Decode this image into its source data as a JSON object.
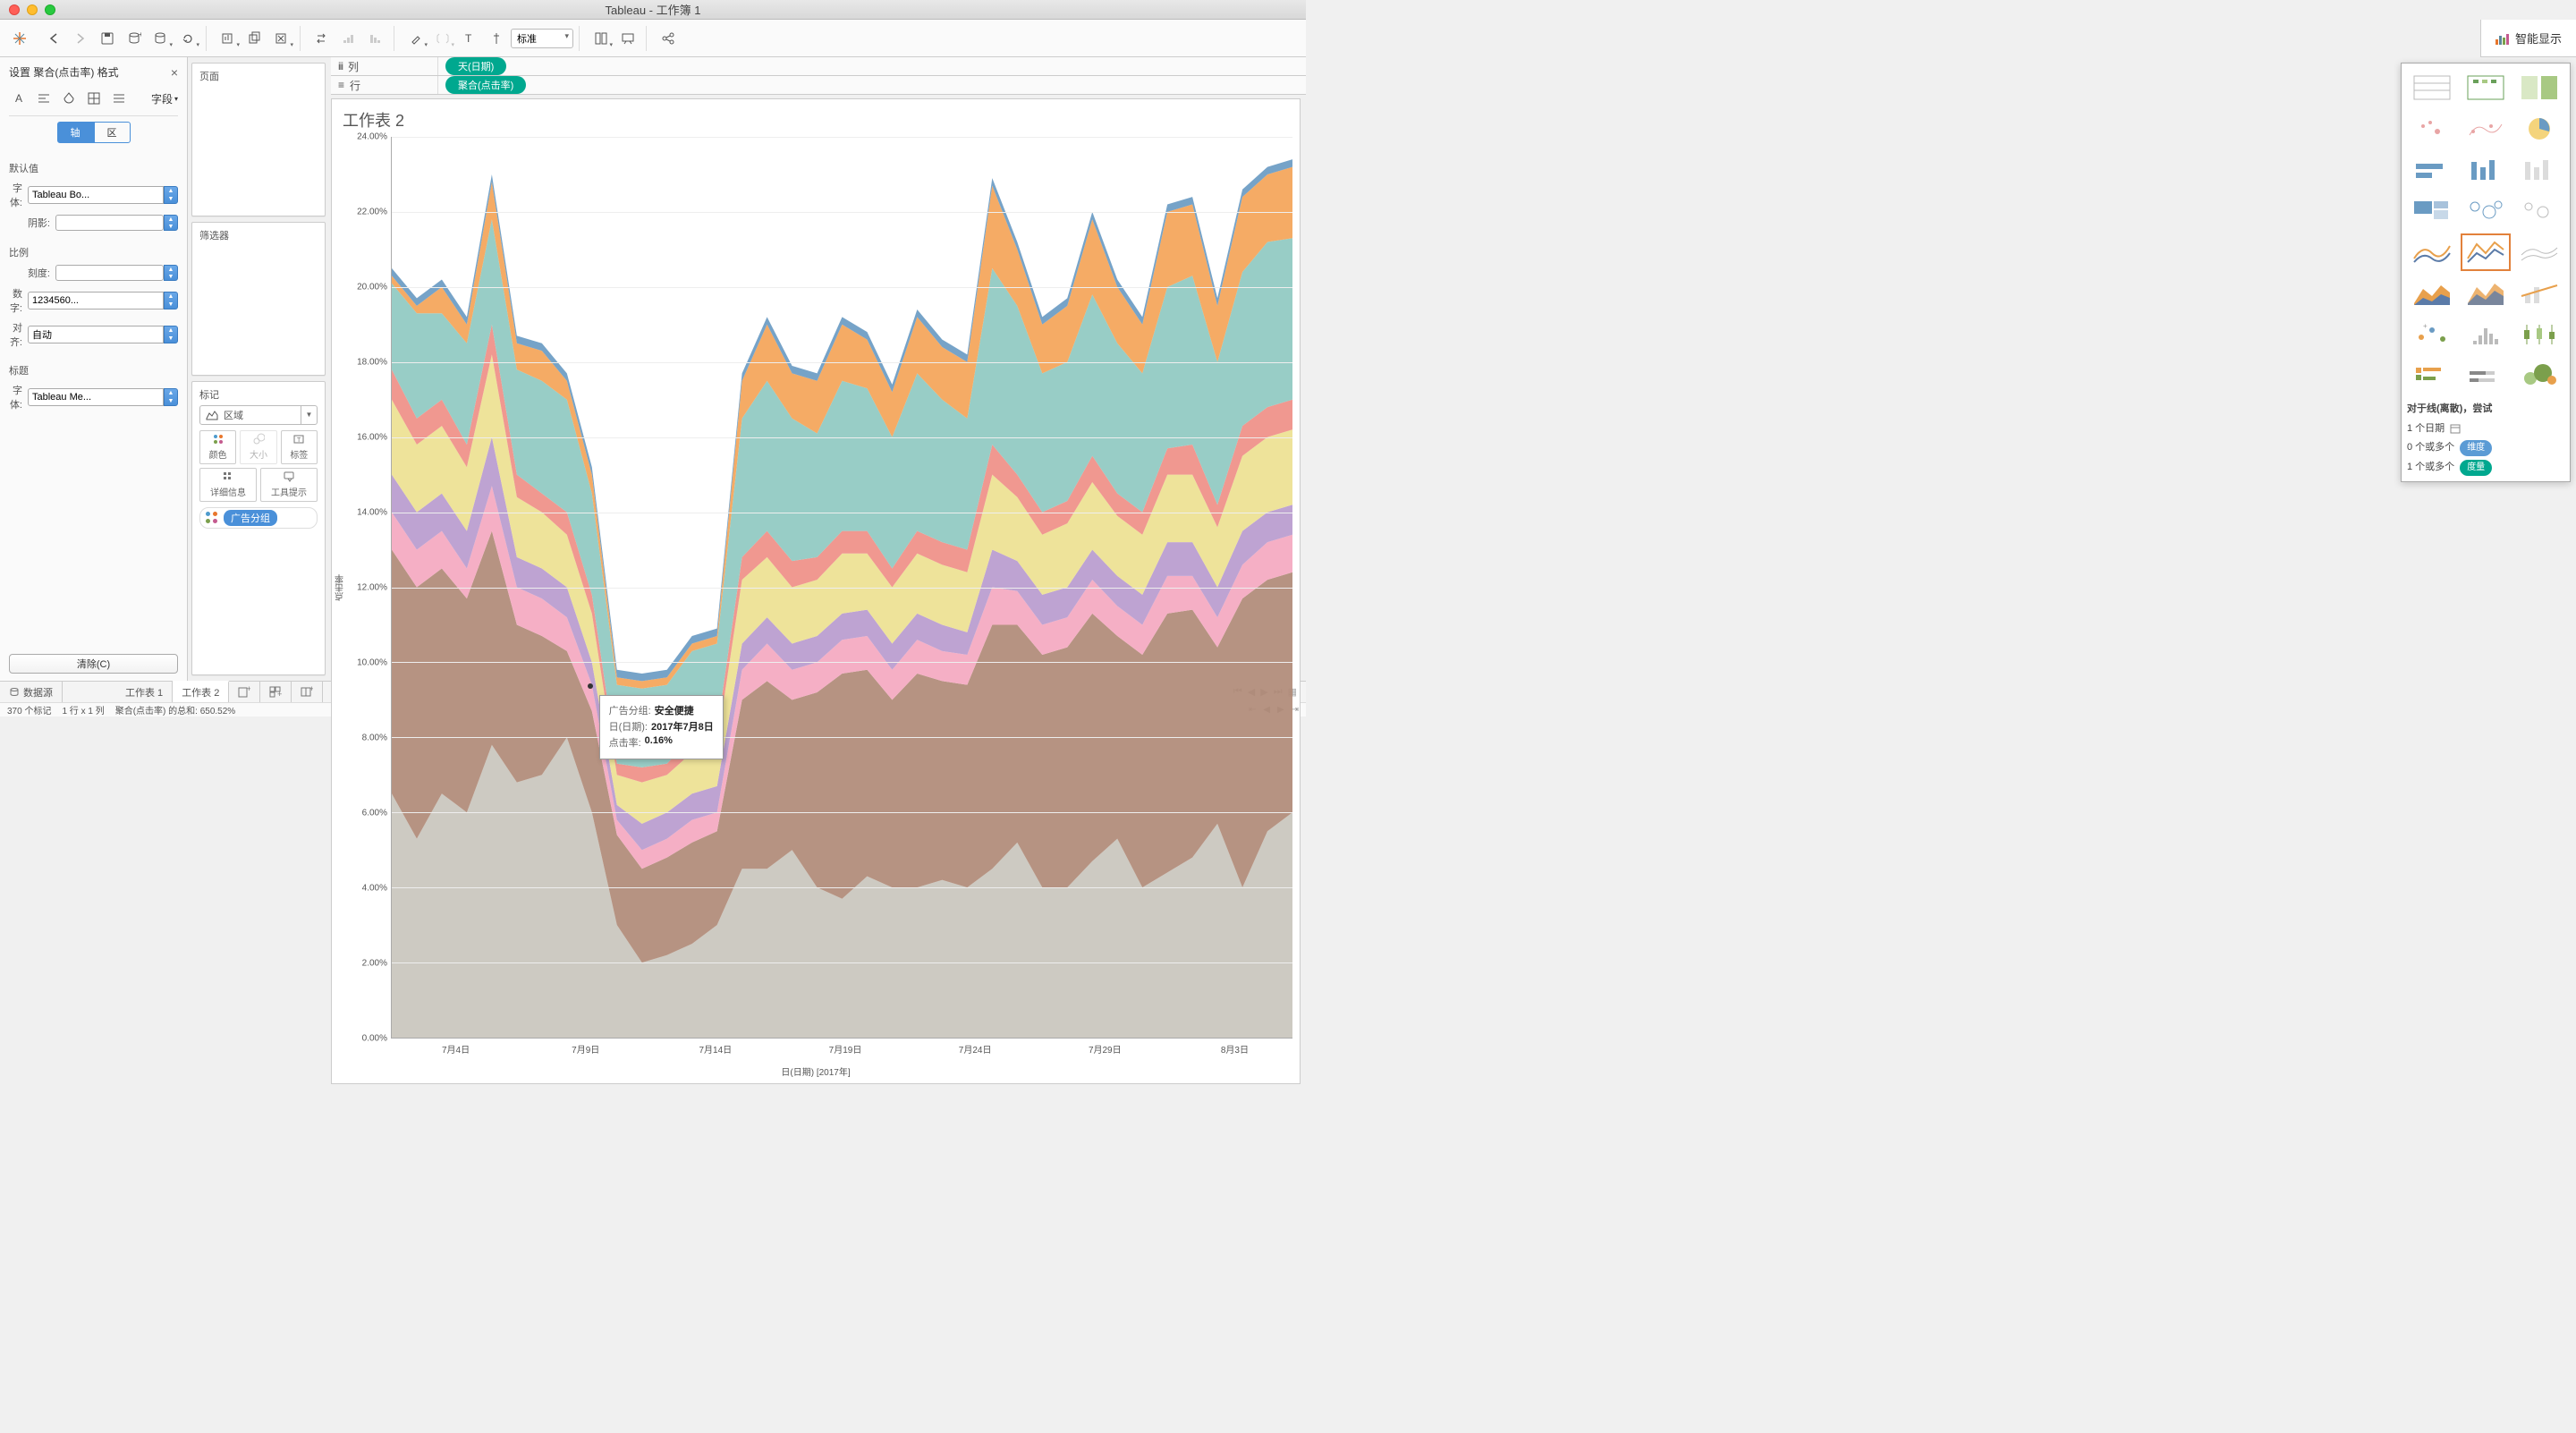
{
  "window": {
    "title": "Tableau - 工作簿 1"
  },
  "toolbar": {
    "standard_label": "标准",
    "showme_label": "智能显示"
  },
  "format_panel": {
    "title": "设置 聚合(点击率) 格式",
    "field_btn": "字段",
    "tab_axis": "轴",
    "tab_pane": "区",
    "section_defaults": "默认值",
    "row_font": "字体:",
    "font_value": "Tableau Bo...",
    "row_shade": "阴影:",
    "section_scale": "比例",
    "row_ticks": "刻度:",
    "row_numbers": "数字:",
    "numbers_value": "1234560...",
    "row_align": "对齐:",
    "align_value": "自动",
    "section_title": "标题",
    "row_font2": "字体:",
    "font2_value": "Tableau Me...",
    "clear_btn": "清除(C)"
  },
  "cards": {
    "pages": "页面",
    "filters": "筛选器",
    "marks": "标记",
    "mark_type": "区域",
    "color": "颜色",
    "size": "大小",
    "label": "标签",
    "detail": "详细信息",
    "tooltip": "工具提示",
    "pill_ad": "广告分组"
  },
  "shelves": {
    "columns": "列",
    "rows": "行",
    "col_pill": "天(日期)",
    "row_pill": "聚合(点击率)"
  },
  "sheet": {
    "title": "工作表 2"
  },
  "tooltip": {
    "k1": "广告分组:",
    "v1": "安全便捷",
    "k2": "日(日期):",
    "v2": "2017年7月8日",
    "k3": "点击率:",
    "v3": "0.16%"
  },
  "axes": {
    "ylabel": "点击率",
    "xlabel": "日(日期) [2017年]"
  },
  "showme": {
    "hint": "对于线(离散)，尝试",
    "l1": "1 个日期",
    "l2": "0 个或多个",
    "chip_dim": "维度",
    "l3": "1 个或多个",
    "chip_meas": "度量"
  },
  "tabs": {
    "datasource": "数据源",
    "ws1": "工作表 1",
    "ws2": "工作表 2"
  },
  "status": {
    "marks": "370 个标记",
    "rc": "1 行 x 1 列",
    "sum": "聚合(点击率) 的总和: 650.52%"
  },
  "chart_data": {
    "type": "area",
    "stacked": true,
    "title": "工作表 2",
    "ylabel": "点击率",
    "xlabel": "日(日期) [2017年]",
    "ylim": [
      0,
      24
    ],
    "y_format": "percent_2dp",
    "y_ticks": [
      "0.00%",
      "2.00%",
      "4.00%",
      "6.00%",
      "8.00%",
      "10.00%",
      "12.00%",
      "14.00%",
      "16.00%",
      "18.00%",
      "20.00%",
      "22.00%",
      "24.00%"
    ],
    "x_ticks": [
      "7月4日",
      "7月9日",
      "7月14日",
      "7月19日",
      "7月24日",
      "7月29日",
      "8月3日"
    ],
    "x_start": "2017-07-01",
    "x_end": "2017-08-06",
    "series_top_to_bottom": [
      "蓝",
      "橙",
      "青",
      "粉",
      "黄",
      "紫",
      "浅粉",
      "棕",
      "灰"
    ],
    "cumulative_top": [
      20.3,
      19.5,
      20.0,
      19.0,
      22.8,
      18.5,
      18.3,
      17.5,
      15.0,
      9.6,
      9.5,
      9.6,
      10.5,
      10.7,
      17.5,
      19.0,
      17.7,
      17.5,
      19.0,
      18.6,
      17.2,
      19.2,
      18.4,
      18.0,
      22.7,
      21.0,
      19.0,
      19.5,
      21.8,
      20.0,
      19.0,
      22.0,
      22.2,
      19.5,
      22.4,
      23.0,
      23.2
    ],
    "cumulative_after_orange": [
      20.1,
      19.3,
      19.3,
      18.5,
      21.8,
      17.8,
      17.5,
      17.0,
      14.5,
      9.4,
      9.3,
      9.4,
      10.3,
      10.5,
      16.5,
      17.5,
      16.5,
      16.1,
      17.5,
      17.3,
      16.0,
      17.7,
      17.0,
      16.5,
      20.5,
      19.5,
      17.7,
      18.0,
      19.8,
      18.5,
      17.7,
      20.0,
      20.3,
      18.0,
      20.4,
      21.2,
      21.3
    ],
    "cumulative_after_teal": [
      17.8,
      16.5,
      17.0,
      15.8,
      19.0,
      15.0,
      14.5,
      14.0,
      11.8,
      7.3,
      7.2,
      7.3,
      8.0,
      8.2,
      12.8,
      13.5,
      12.7,
      12.8,
      13.5,
      13.5,
      12.5,
      13.5,
      13.2,
      13.0,
      15.8,
      15.0,
      14.0,
      14.3,
      15.5,
      14.5,
      14.0,
      15.7,
      15.8,
      14.2,
      16.3,
      16.8,
      17.0
    ],
    "cumulative_after_salmon": [
      17.0,
      15.8,
      16.3,
      15.2,
      18.2,
      14.4,
      14.0,
      13.4,
      11.3,
      7.0,
      6.8,
      7.0,
      7.6,
      7.8,
      12.2,
      12.8,
      12.0,
      12.2,
      12.9,
      12.9,
      12.0,
      12.9,
      12.6,
      12.4,
      15.0,
      14.4,
      13.4,
      13.7,
      14.8,
      13.9,
      13.4,
      15.0,
      15.0,
      13.6,
      15.5,
      16.0,
      16.2
    ],
    "cumulative_after_yellow": [
      15.0,
      14.0,
      14.5,
      13.5,
      16.0,
      12.8,
      12.5,
      12.0,
      10.0,
      6.2,
      5.7,
      6.0,
      6.5,
      6.7,
      10.5,
      11.2,
      10.5,
      10.7,
      11.3,
      11.4,
      10.5,
      11.3,
      11.0,
      10.8,
      13.0,
      12.7,
      11.8,
      12.0,
      13.0,
      12.3,
      11.8,
      13.2,
      13.2,
      12.0,
      13.5,
      14.0,
      14.2
    ],
    "cumulative_after_purple": [
      14.0,
      13.0,
      13.5,
      12.5,
      14.7,
      12.0,
      11.7,
      11.2,
      9.4,
      5.8,
      5.0,
      5.3,
      5.8,
      6.0,
      9.8,
      10.5,
      9.8,
      10.0,
      10.6,
      10.7,
      9.8,
      10.6,
      10.3,
      10.2,
      12.0,
      11.9,
      11.0,
      11.2,
      12.2,
      11.5,
      11.0,
      12.3,
      12.3,
      11.2,
      12.6,
      13.2,
      13.4
    ],
    "cumulative_after_pink": [
      13.0,
      12.0,
      12.5,
      11.7,
      13.5,
      11.0,
      10.7,
      10.3,
      8.7,
      5.4,
      4.5,
      4.8,
      5.2,
      5.5,
      9.0,
      9.5,
      9.0,
      9.2,
      9.7,
      9.8,
      9.0,
      9.7,
      9.5,
      9.4,
      11.0,
      11.0,
      10.2,
      10.4,
      11.3,
      10.7,
      10.2,
      11.3,
      11.4,
      10.4,
      11.7,
      12.2,
      12.4
    ],
    "cumulative_after_brown": [
      6.5,
      5.3,
      6.5,
      6.0,
      7.8,
      6.8,
      7.0,
      8.0,
      6.0,
      3.0,
      2.0,
      2.2,
      2.5,
      3.0,
      4.5,
      4.5,
      5.0,
      4.0,
      3.7,
      4.3,
      4.0,
      4.0,
      4.2,
      4.0,
      4.5,
      5.2,
      4.0,
      4.0,
      4.7,
      5.3,
      4.0,
      4.4,
      4.8,
      5.7,
      4.0,
      5.5,
      6.0
    ],
    "tooltip_sample": {
      "广告分组": "安全便捷",
      "日(日期)": "2017年7月8日",
      "点击率": "0.16%"
    }
  }
}
